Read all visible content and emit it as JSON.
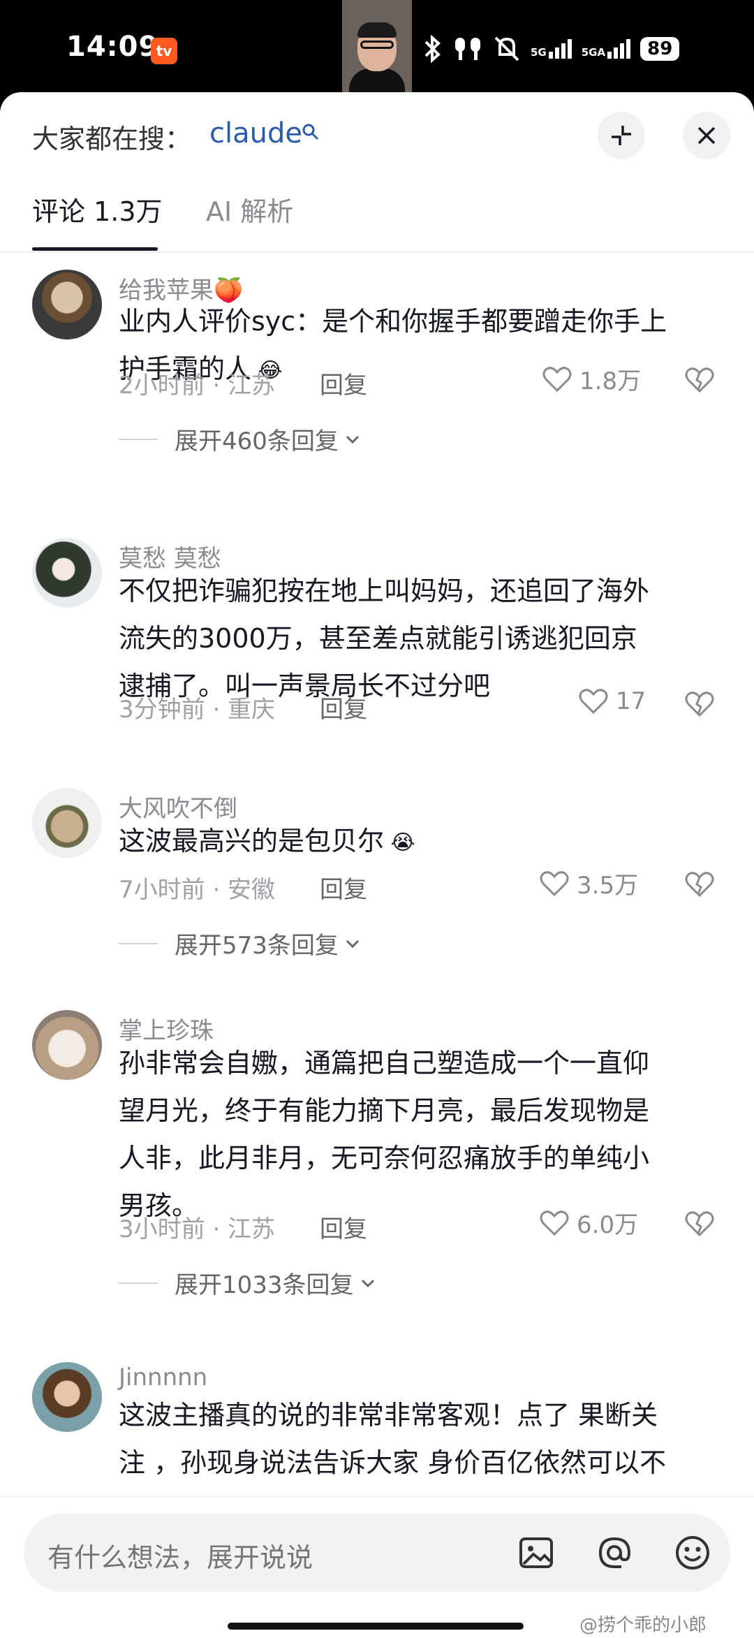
{
  "status_bar": {
    "time": "14:09",
    "app_badge": "tv",
    "sig1": "5G",
    "sig2": "5GA",
    "battery": "89"
  },
  "search": {
    "label": "大家都在搜：",
    "term": "claude"
  },
  "tabs": [
    {
      "label": "评论 1.3万",
      "active": true
    },
    {
      "label": "AI 解析",
      "active": false
    }
  ],
  "comments": [
    {
      "username": "给我苹果🍑",
      "lines": [
        "业内人评价syc：是个和你握手都要蹭走你手上",
        "护手霜的人"
      ],
      "emoji": "😂",
      "time_location": "2小时前 · 江苏",
      "reply_label": "回复",
      "likes": "1.8万",
      "expand": "展开460条回复"
    },
    {
      "username": "莫愁  莫愁",
      "lines": [
        "不仅把诈骗犯按在地上叫妈妈，还追回了海外",
        "流失的3000万，甚至差点就能引诱逃犯回京",
        "逮捕了。叫一声景局长不过分吧"
      ],
      "emoji": "",
      "time_location": "3分钟前 · 重庆",
      "reply_label": "回复",
      "likes": "17",
      "expand": ""
    },
    {
      "username": "大风吹不倒",
      "lines": [
        "这波最高兴的是包贝尔"
      ],
      "emoji": "😭",
      "time_location": "7小时前 · 安徽",
      "reply_label": "回复",
      "likes": "3.5万",
      "expand": "展开573条回复"
    },
    {
      "username": "掌上珍珠",
      "lines": [
        "孙非常会自嫐，通篇把自己塑造成一个一直仰",
        "望月光，终于有能力摘下月亮，最后发现物是",
        "人非，此月非月，无可奈何忍痛放手的单纯小",
        "男孩。"
      ],
      "emoji": "",
      "time_location": "3小时前 · 江苏",
      "reply_label": "回复",
      "likes": "6.0万",
      "expand": "展开1033条回复"
    },
    {
      "username": "Jinnnnn",
      "lines": [
        "这波主播真的说的非常非常客观！点了 果断关",
        "注 ，孙现身说法告诉大家 身价百亿依然可以不"
      ],
      "emoji": "",
      "time_location": "",
      "reply_label": "",
      "likes": "",
      "expand": ""
    }
  ],
  "input": {
    "placeholder": "有什么想法，展开说说"
  },
  "watermark": "@捞个乖的小郎",
  "colors": {
    "accent_link": "#2a5caa",
    "sheet_bg": "#ffffff",
    "statusbar_bg": "#000000"
  }
}
